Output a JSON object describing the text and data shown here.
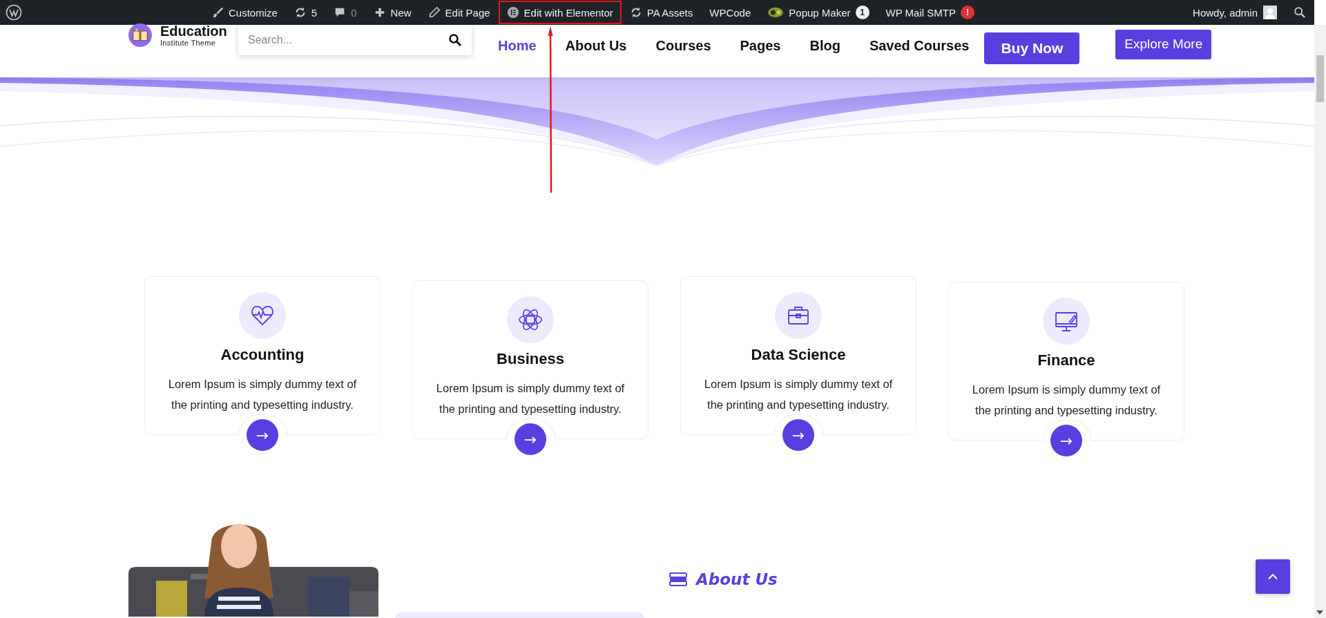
{
  "admin_bar": {
    "items": [
      {
        "kind": "customize",
        "label": "Customize",
        "highlighted": false
      },
      {
        "kind": "updates",
        "label": "5",
        "highlighted": false
      },
      {
        "kind": "comments",
        "label": "0",
        "highlighted": false
      },
      {
        "kind": "new",
        "label": "New",
        "highlighted": false
      },
      {
        "kind": "edit",
        "label": "Edit Page",
        "highlighted": false
      },
      {
        "kind": "elementor",
        "label": "Edit with Elementor",
        "highlighted": true
      },
      {
        "kind": "assets",
        "label": "PA Assets",
        "highlighted": false
      },
      {
        "kind": "plain",
        "label": "WPCode",
        "highlighted": false
      },
      {
        "kind": "popup",
        "label": "Popup Maker",
        "badge": "1",
        "highlighted": false
      },
      {
        "kind": "mail",
        "label": "WP Mail SMTP",
        "badge": "!",
        "highlighted": false
      }
    ],
    "greeting": "Howdy, admin"
  },
  "header": {
    "logo": {
      "title": "Education",
      "subtitle": "Institute Theme"
    },
    "search": {
      "placeholder": "Search..."
    },
    "nav": [
      {
        "label": "Home",
        "selected": true
      },
      {
        "label": "About Us",
        "selected": false
      },
      {
        "label": "Courses",
        "selected": false
      },
      {
        "label": "Pages",
        "selected": false
      },
      {
        "label": "Blog",
        "selected": false
      },
      {
        "label": "Saved Courses",
        "selected": false
      }
    ],
    "buttons": [
      "Buy Now",
      "Explore More"
    ]
  },
  "cards": [
    {
      "kind": "heart",
      "title": "Accounting",
      "text": "Lorem Ipsum is simply dummy text of the printing and typesetting industry.",
      "link": "→"
    },
    {
      "kind": "atom",
      "title": "Business",
      "text": "Lorem Ipsum is simply dummy text of the printing and typesetting industry.",
      "link": "→"
    },
    {
      "kind": "briefcase",
      "title": "Data Science",
      "text": "Lorem Ipsum is simply dummy text of the printing and typesetting industry.",
      "link": "→"
    },
    {
      "kind": "monitor",
      "title": "Finance",
      "text": "Lorem Ipsum is simply dummy text of the printing and typesetting industry.",
      "link": "→"
    }
  ],
  "about": {
    "label": "About Us"
  }
}
